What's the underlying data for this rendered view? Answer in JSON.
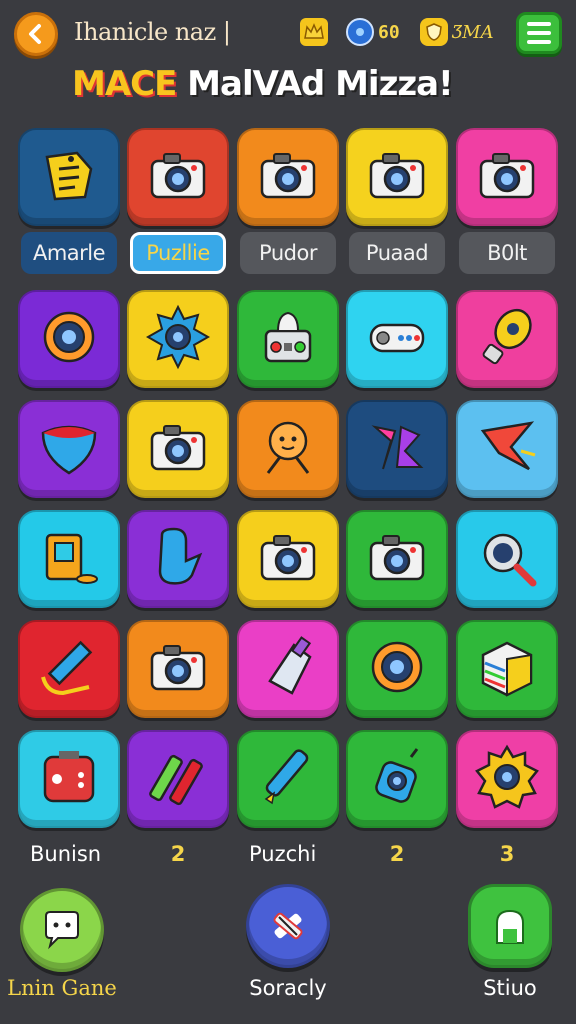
{
  "header": {
    "title": "Ihanicle naz |",
    "headline_part1": "MACE",
    "headline_part2": " MalVAd Mizza!",
    "stats": [
      {
        "icon": "crown-icon",
        "value": ""
      },
      {
        "icon": "gem-icon",
        "value": "60"
      },
      {
        "icon": "shield-icon",
        "value": "ƷMA"
      }
    ]
  },
  "grid": {
    "row1": [
      {
        "icon": "tag-icon",
        "color": "#1f5a8f"
      },
      {
        "icon": "camera-icon",
        "color": "#e0452f"
      },
      {
        "icon": "camera-icon",
        "color": "#f28a1c"
      },
      {
        "icon": "camera-icon",
        "color": "#f5d21e"
      },
      {
        "icon": "camera-icon",
        "color": "#f03fa3"
      }
    ],
    "row1_labels": [
      "Amarle",
      "Puzllie",
      "Pudor",
      "Puaad",
      "B0lt"
    ],
    "row2": [
      {
        "icon": "lens-icon",
        "color": "#7b2ad6"
      },
      {
        "icon": "gear-lens-icon",
        "color": "#f5cf1c"
      },
      {
        "icon": "robot-icon",
        "color": "#2fb83a"
      },
      {
        "icon": "gamepad-icon",
        "color": "#2fd3f0"
      },
      {
        "icon": "lightbulb-icon",
        "color": "#ef3f9e"
      }
    ],
    "row3": [
      {
        "icon": "heart-icon",
        "color": "#8a2fd6"
      },
      {
        "icon": "camera-icon",
        "color": "#f5cf1c"
      },
      {
        "icon": "creature-icon",
        "color": "#f28a1c"
      },
      {
        "icon": "graffiti-icon",
        "color": "#1e4c7f"
      },
      {
        "icon": "star-icon",
        "color": "#5cc0f0"
      }
    ],
    "row4": [
      {
        "icon": "frame-icon",
        "color": "#24c9e8"
      },
      {
        "icon": "seat-icon",
        "color": "#8a2fd6"
      },
      {
        "icon": "camera-icon",
        "color": "#f5cf1c"
      },
      {
        "icon": "camera-icon",
        "color": "#2fb83a"
      },
      {
        "icon": "magnifier-icon",
        "color": "#28c9ea"
      }
    ],
    "row5": [
      {
        "icon": "pencil-icon",
        "color": "#e0252f"
      },
      {
        "icon": "camera-icon",
        "color": "#f28a1c"
      },
      {
        "icon": "brush-icon",
        "color": "#ea3fc6"
      },
      {
        "icon": "lens-icon",
        "color": "#2fb83a"
      },
      {
        "icon": "box-icon",
        "color": "#2fb83a"
      }
    ],
    "row6": [
      {
        "icon": "console-icon",
        "color": "#2fcbe6"
      },
      {
        "icon": "markers-icon",
        "color": "#8a2fd6"
      },
      {
        "icon": "pen-icon",
        "color": "#2fb83a"
      },
      {
        "icon": "robot-camera-icon",
        "color": "#2fb83a"
      },
      {
        "icon": "gear-icon",
        "color": "#ef3fa6"
      }
    ],
    "row6_labels": [
      "Bunisn",
      "2",
      "Puzchi",
      "2",
      "3"
    ]
  },
  "nav": {
    "left_label": "Lnin Gane",
    "center_label": "Soracly",
    "right_label": "Stiuo",
    "left_icon": "chat-icon",
    "center_icon": "tools-icon",
    "right_icon": "door-icon"
  },
  "colors": {
    "background": "#3a3b40",
    "accent": "#f5d54a",
    "selected_pill": "#38a8e8"
  }
}
